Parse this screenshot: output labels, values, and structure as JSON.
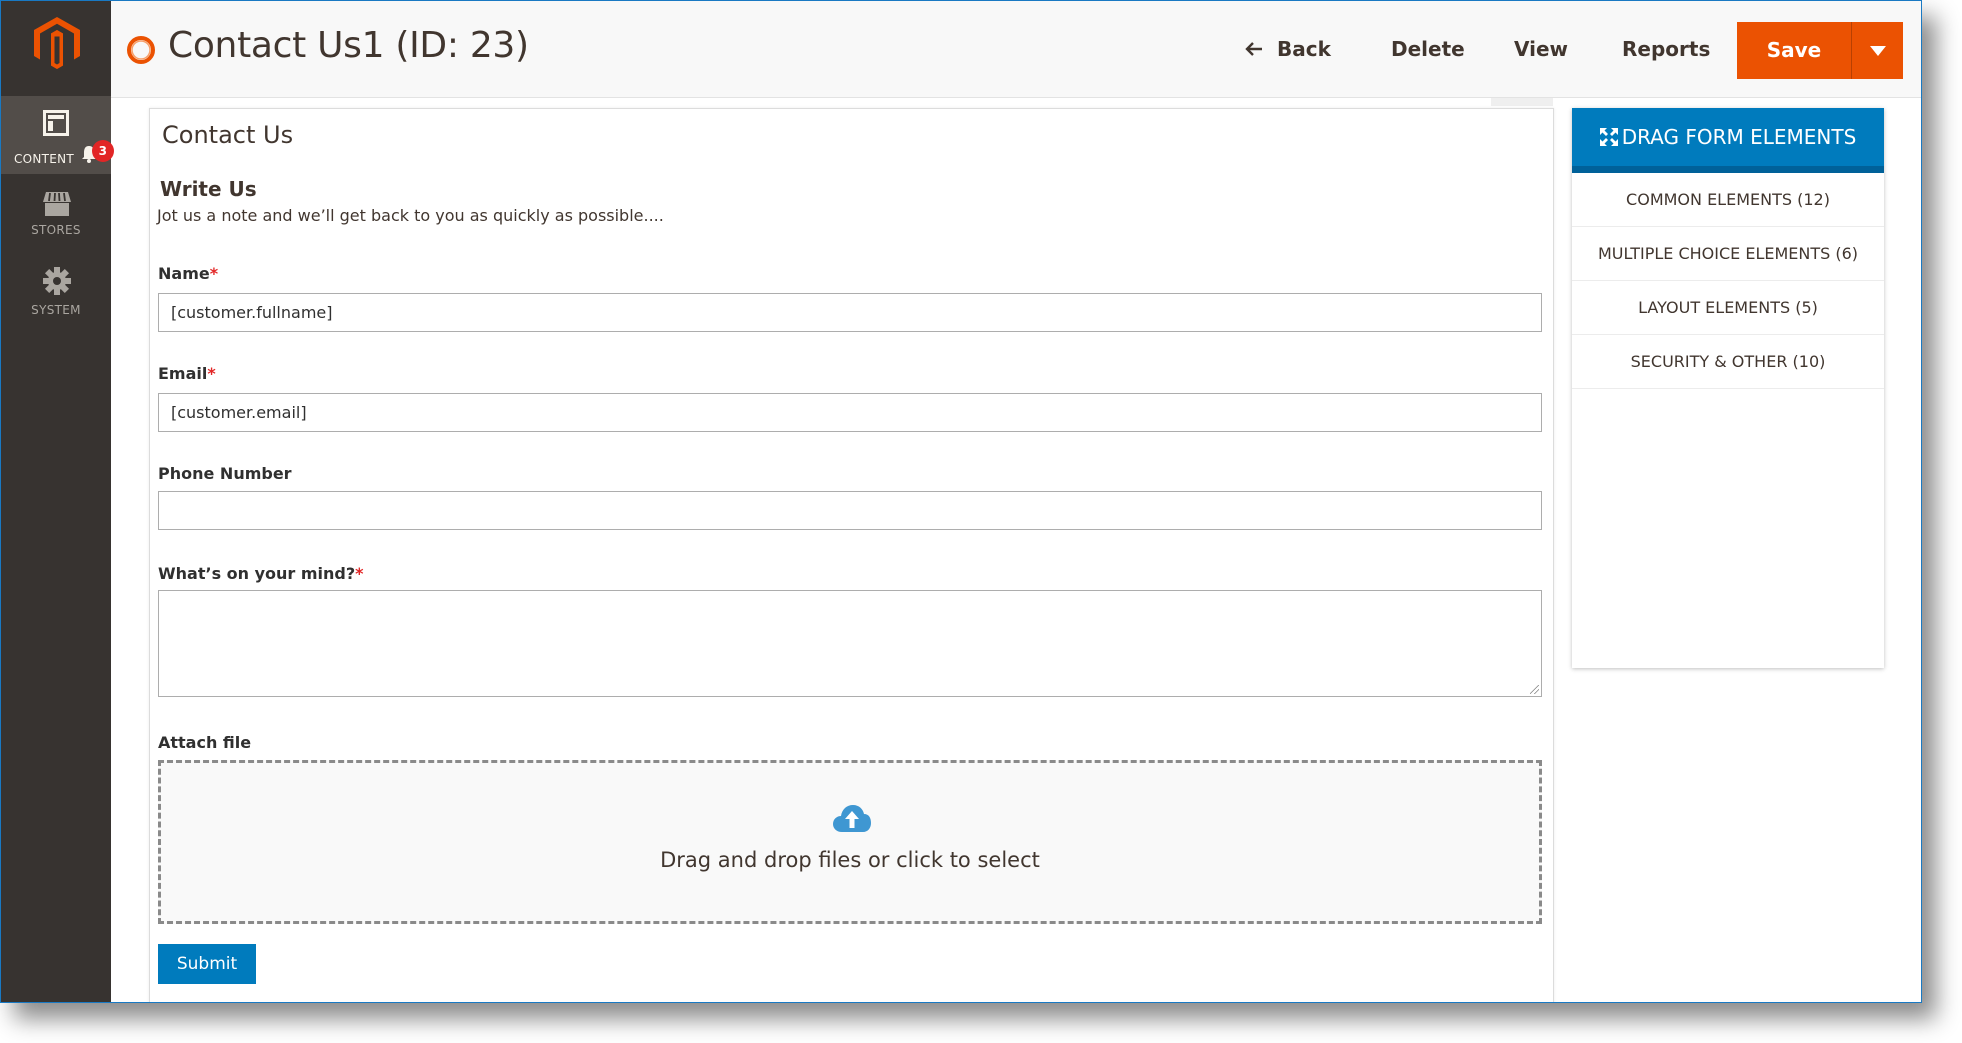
{
  "sidebar": {
    "logo": "magento-logo",
    "items": [
      {
        "label": "CONTENT",
        "icon": "content-layout-icon",
        "active": true,
        "badge": "3"
      },
      {
        "label": "STORES",
        "icon": "store-icon",
        "active": false
      },
      {
        "label": "SYSTEM",
        "icon": "gear-icon",
        "active": false
      }
    ]
  },
  "header": {
    "title": "Contact Us1 (ID: 23)",
    "title_icon": "loading-ring-icon",
    "buttons": {
      "back": "Back",
      "delete": "Delete",
      "view": "View",
      "reports": "Reports",
      "save": "Save"
    }
  },
  "form": {
    "card_title": "Contact Us",
    "section_title": "Write Us",
    "section_description": "Jot us a note and we’ll get back to you as quickly as possible....",
    "fields": [
      {
        "label": "Name",
        "required": "*",
        "value": "[customer.fullname]",
        "placeholder": ""
      },
      {
        "label": "Email",
        "required": "*",
        "value": "[customer.email]",
        "placeholder": ""
      },
      {
        "label": "Phone Number",
        "required": "",
        "value": "",
        "placeholder": ""
      },
      {
        "label": "What’s on your mind?",
        "required": "*",
        "value": ""
      }
    ],
    "attach": {
      "label": "Attach file",
      "dropzone_text": "Drag and drop files or click to select"
    },
    "submit_label": "Submit"
  },
  "right_panel": {
    "header": "DRAG FORM ELEMENTS",
    "items": [
      "COMMON ELEMENTS (12)",
      "MULTIPLE CHOICE ELEMENTS (6)",
      "LAYOUT ELEMENTS (5)",
      "SECURITY & OTHER (10)"
    ]
  },
  "colors": {
    "accent": "#eb5202",
    "primary": "#007bbd",
    "sidebar_bg": "#373330",
    "badge": "#e22626"
  }
}
